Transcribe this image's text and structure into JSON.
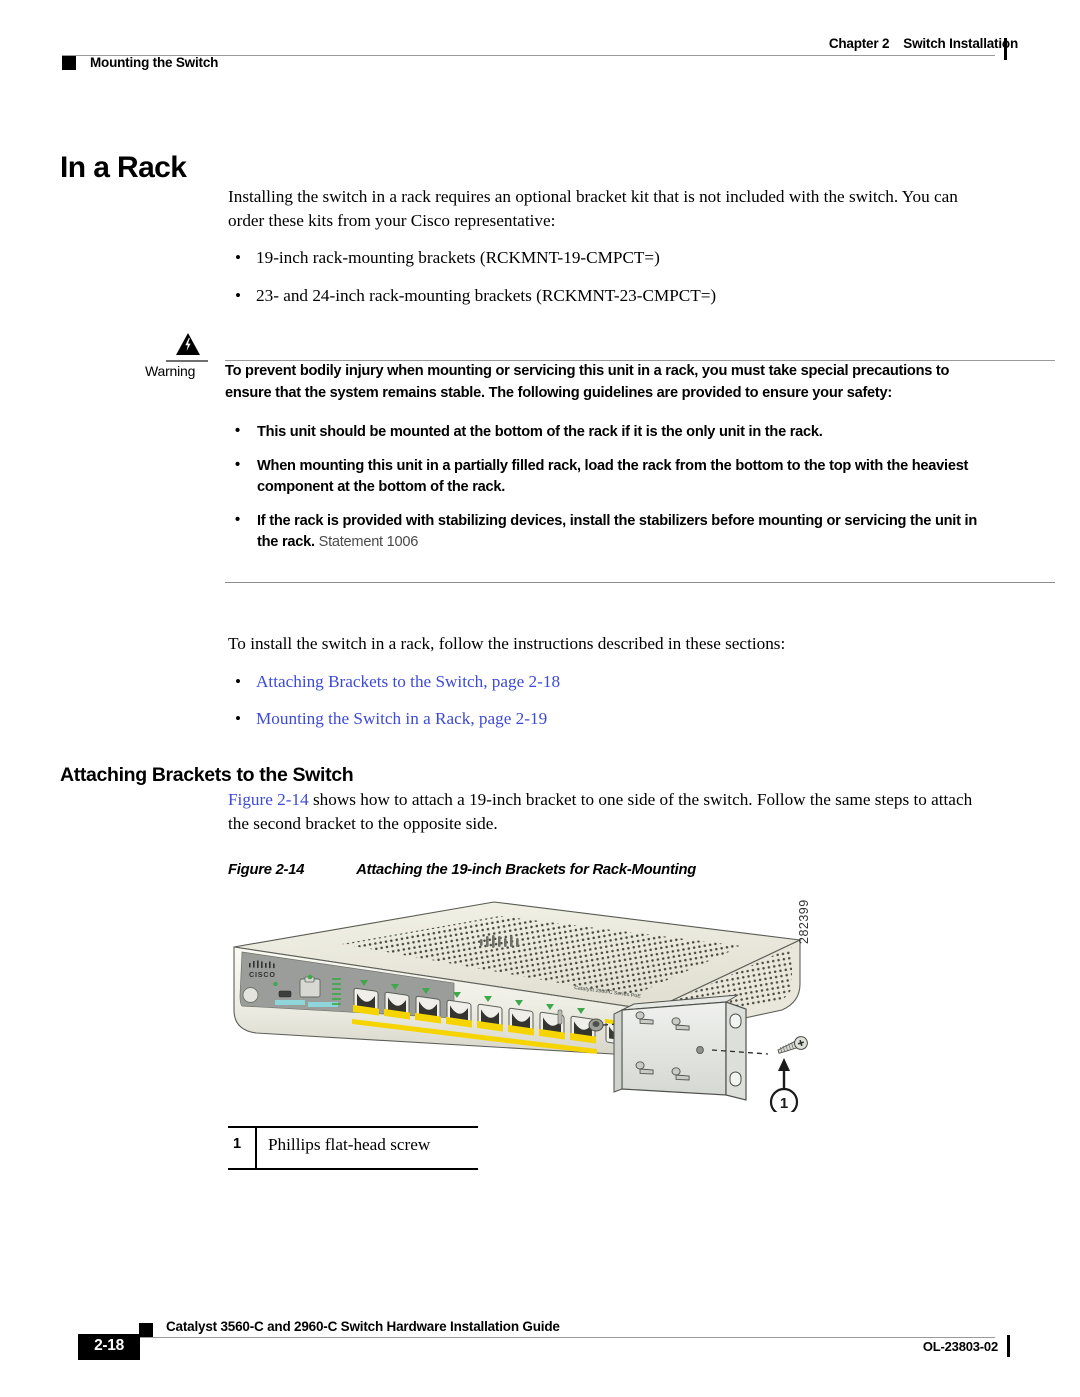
{
  "header": {
    "chapter": "Chapter 2",
    "chapter_title": "Switch Installation",
    "section": "Mounting the Switch"
  },
  "title": "In a Rack",
  "intro": {
    "paragraph": "Installing the switch in a rack requires an optional bracket kit that is not included with the switch. You can order these kits from your Cisco representative:",
    "bullets": [
      "19-inch rack-mounting brackets (RCKMNT-19-CMPCT=)",
      "23- and 24-inch rack-mounting brackets (RCKMNT-23-CMPCT=)"
    ]
  },
  "warning": {
    "label": "Warning",
    "icon": "warning-triangle-lightning-icon",
    "lead": "To prevent bodily injury when mounting or servicing this unit in a rack, you must take special precautions to ensure that the system remains stable. The following guidelines are provided to ensure your safety:",
    "bullets": [
      "This unit should be mounted at the bottom of the rack if it is the only unit in the rack.",
      "When mounting this unit in a partially filled rack, load the rack from the bottom to the top with the heaviest component at the bottom of the rack.",
      "If the rack is provided with stabilizing devices, install the stabilizers before mounting or servicing the unit in the rack."
    ],
    "statement": "Statement 1006"
  },
  "sections_intro": {
    "paragraph": "To install the switch in a rack, follow the instructions described in these sections:",
    "links": [
      "Attaching Brackets to the Switch, page 2-18",
      "Mounting the Switch in a Rack, page 2-19"
    ]
  },
  "subsection": {
    "heading": "Attaching Brackets to the Switch",
    "paragraph_link": "Figure 2-14",
    "paragraph_rest": " shows how to attach a 19-inch bracket to one side of the switch. Follow the same steps to attach the second bracket to the opposite side."
  },
  "figure": {
    "number": "Figure 2-14",
    "title": "Attaching the 19-inch Brackets for Rack-Mounting",
    "art_id": "282399",
    "callout": "1",
    "switch_brand": "CISCO",
    "switch_model": "Catalyst 2960-C Series PoE"
  },
  "legend": {
    "number": "1",
    "text": "Phillips flat-head screw"
  },
  "footer": {
    "guide": "Catalyst 3560-C and 2960-C Switch Hardware Installation Guide",
    "page": "2-18",
    "doc_id": "OL-23803-02"
  },
  "colors": {
    "link": "#3d4ad6",
    "rule": "#9a9a9a",
    "text": "#000000"
  }
}
